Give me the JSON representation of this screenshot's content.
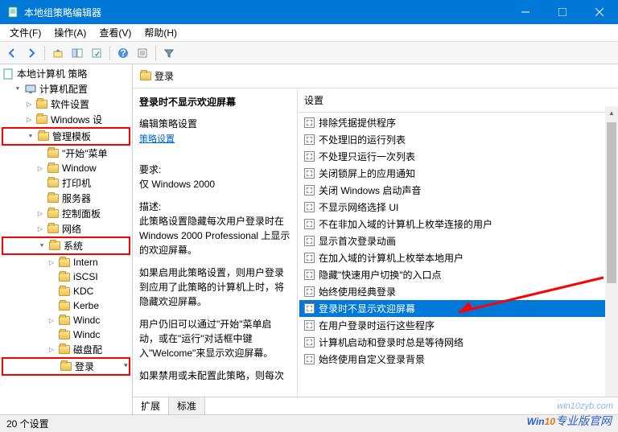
{
  "window": {
    "title": "本地组策略编辑器"
  },
  "menu": {
    "file": "文件(F)",
    "action": "操作(A)",
    "view": "查看(V)",
    "help": "帮助(H)"
  },
  "tree": {
    "root": "本地计算机 策略",
    "computer": "计算机配置",
    "software": "软件设置",
    "windows_set": "Windows 设",
    "admin_tpl": "管理模板",
    "start_menu": "\"开始\"菜单",
    "win": "Window",
    "printer": "打印机",
    "server": "服务器",
    "ctrl_panel": "控制面板",
    "network": "网络",
    "system": "系统",
    "intern": "Intern",
    "iscsi": "iSCSI",
    "kdc": "KDC",
    "kerbe": "Kerbe",
    "windc1": "Windc",
    "windc2": "Windc",
    "disk": "磁盘配",
    "login": "登录"
  },
  "right": {
    "header": "登录",
    "desc_title": "登录时不显示欢迎屏幕",
    "edit_link": "编辑策略设置",
    "req_label": "要求:",
    "req_value": "仅 Windows 2000",
    "desc_label": "描述:",
    "desc_p1": "此策略设置隐藏每次用户登录时在 Windows 2000 Professional 上显示的欢迎屏幕。",
    "desc_p2": "如果启用此策略设置，则用户登录到应用了此策略的计算机上时，将隐藏欢迎屏幕。",
    "desc_p3": "用户仍旧可以通过\"开始\"菜单启动，或在\"运行\"对话框中键入\"Welcome\"来显示欢迎屏幕。",
    "desc_p4": "如果禁用或未配置此策略，则每次",
    "settings_header": "设置",
    "settings": [
      "排除凭据提供程序",
      "不处理旧的运行列表",
      "不处理只运行一次列表",
      "关闭锁屏上的应用通知",
      "关闭 Windows 启动声音",
      "不显示网络选择 UI",
      "不在非加入域的计算机上枚举连接的用户",
      "显示首次登录动画",
      "在加入域的计算机上枚举本地用户",
      "隐藏\"快速用户切换\"的入口点",
      "始终使用经典登录",
      "登录时不显示欢迎屏幕",
      "在用户登录时运行这些程序",
      "计算机启动和登录时总是等待网络",
      "始终使用自定义登录背景"
    ],
    "selected_index": 11,
    "tab_extended": "扩展",
    "tab_standard": "标准"
  },
  "status": {
    "count": "20 个设置"
  },
  "watermark1": "win10zyb.com",
  "watermark2_a": "Win",
  "watermark2_b": "10",
  "watermark2_c": "专业版官网"
}
